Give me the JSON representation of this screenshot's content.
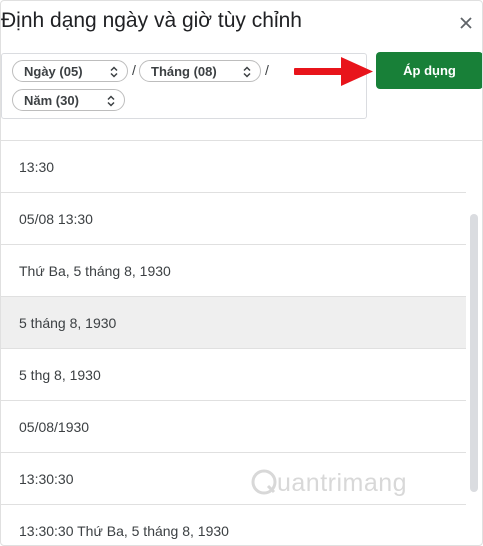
{
  "dialog": {
    "title": "Định dạng ngày và giờ tùy chỉnh",
    "close_icon": "close-icon"
  },
  "format": {
    "chips": [
      {
        "label": "Ngày (05)"
      },
      {
        "label": "Tháng (08)"
      },
      {
        "label": "Năm (30)"
      }
    ],
    "separators": [
      "/",
      "/"
    ]
  },
  "apply_button": {
    "label": "Áp dụng",
    "color": "#188038"
  },
  "annotation": {
    "arrow_color": "#e8141b"
  },
  "format_list": [
    {
      "text": "13:30"
    },
    {
      "text": "05/08 13:30"
    },
    {
      "text": "Thứ Ba, 5 tháng 8, 1930"
    },
    {
      "text": "5 tháng 8, 1930",
      "selected": true
    },
    {
      "text": "5 thg 8, 1930"
    },
    {
      "text": "05/08/1930"
    },
    {
      "text": "13:30:30"
    },
    {
      "text": "13:30:30 Thứ Ba, 5 tháng 8, 1930"
    }
  ],
  "watermark": {
    "text": "uantrimang"
  }
}
